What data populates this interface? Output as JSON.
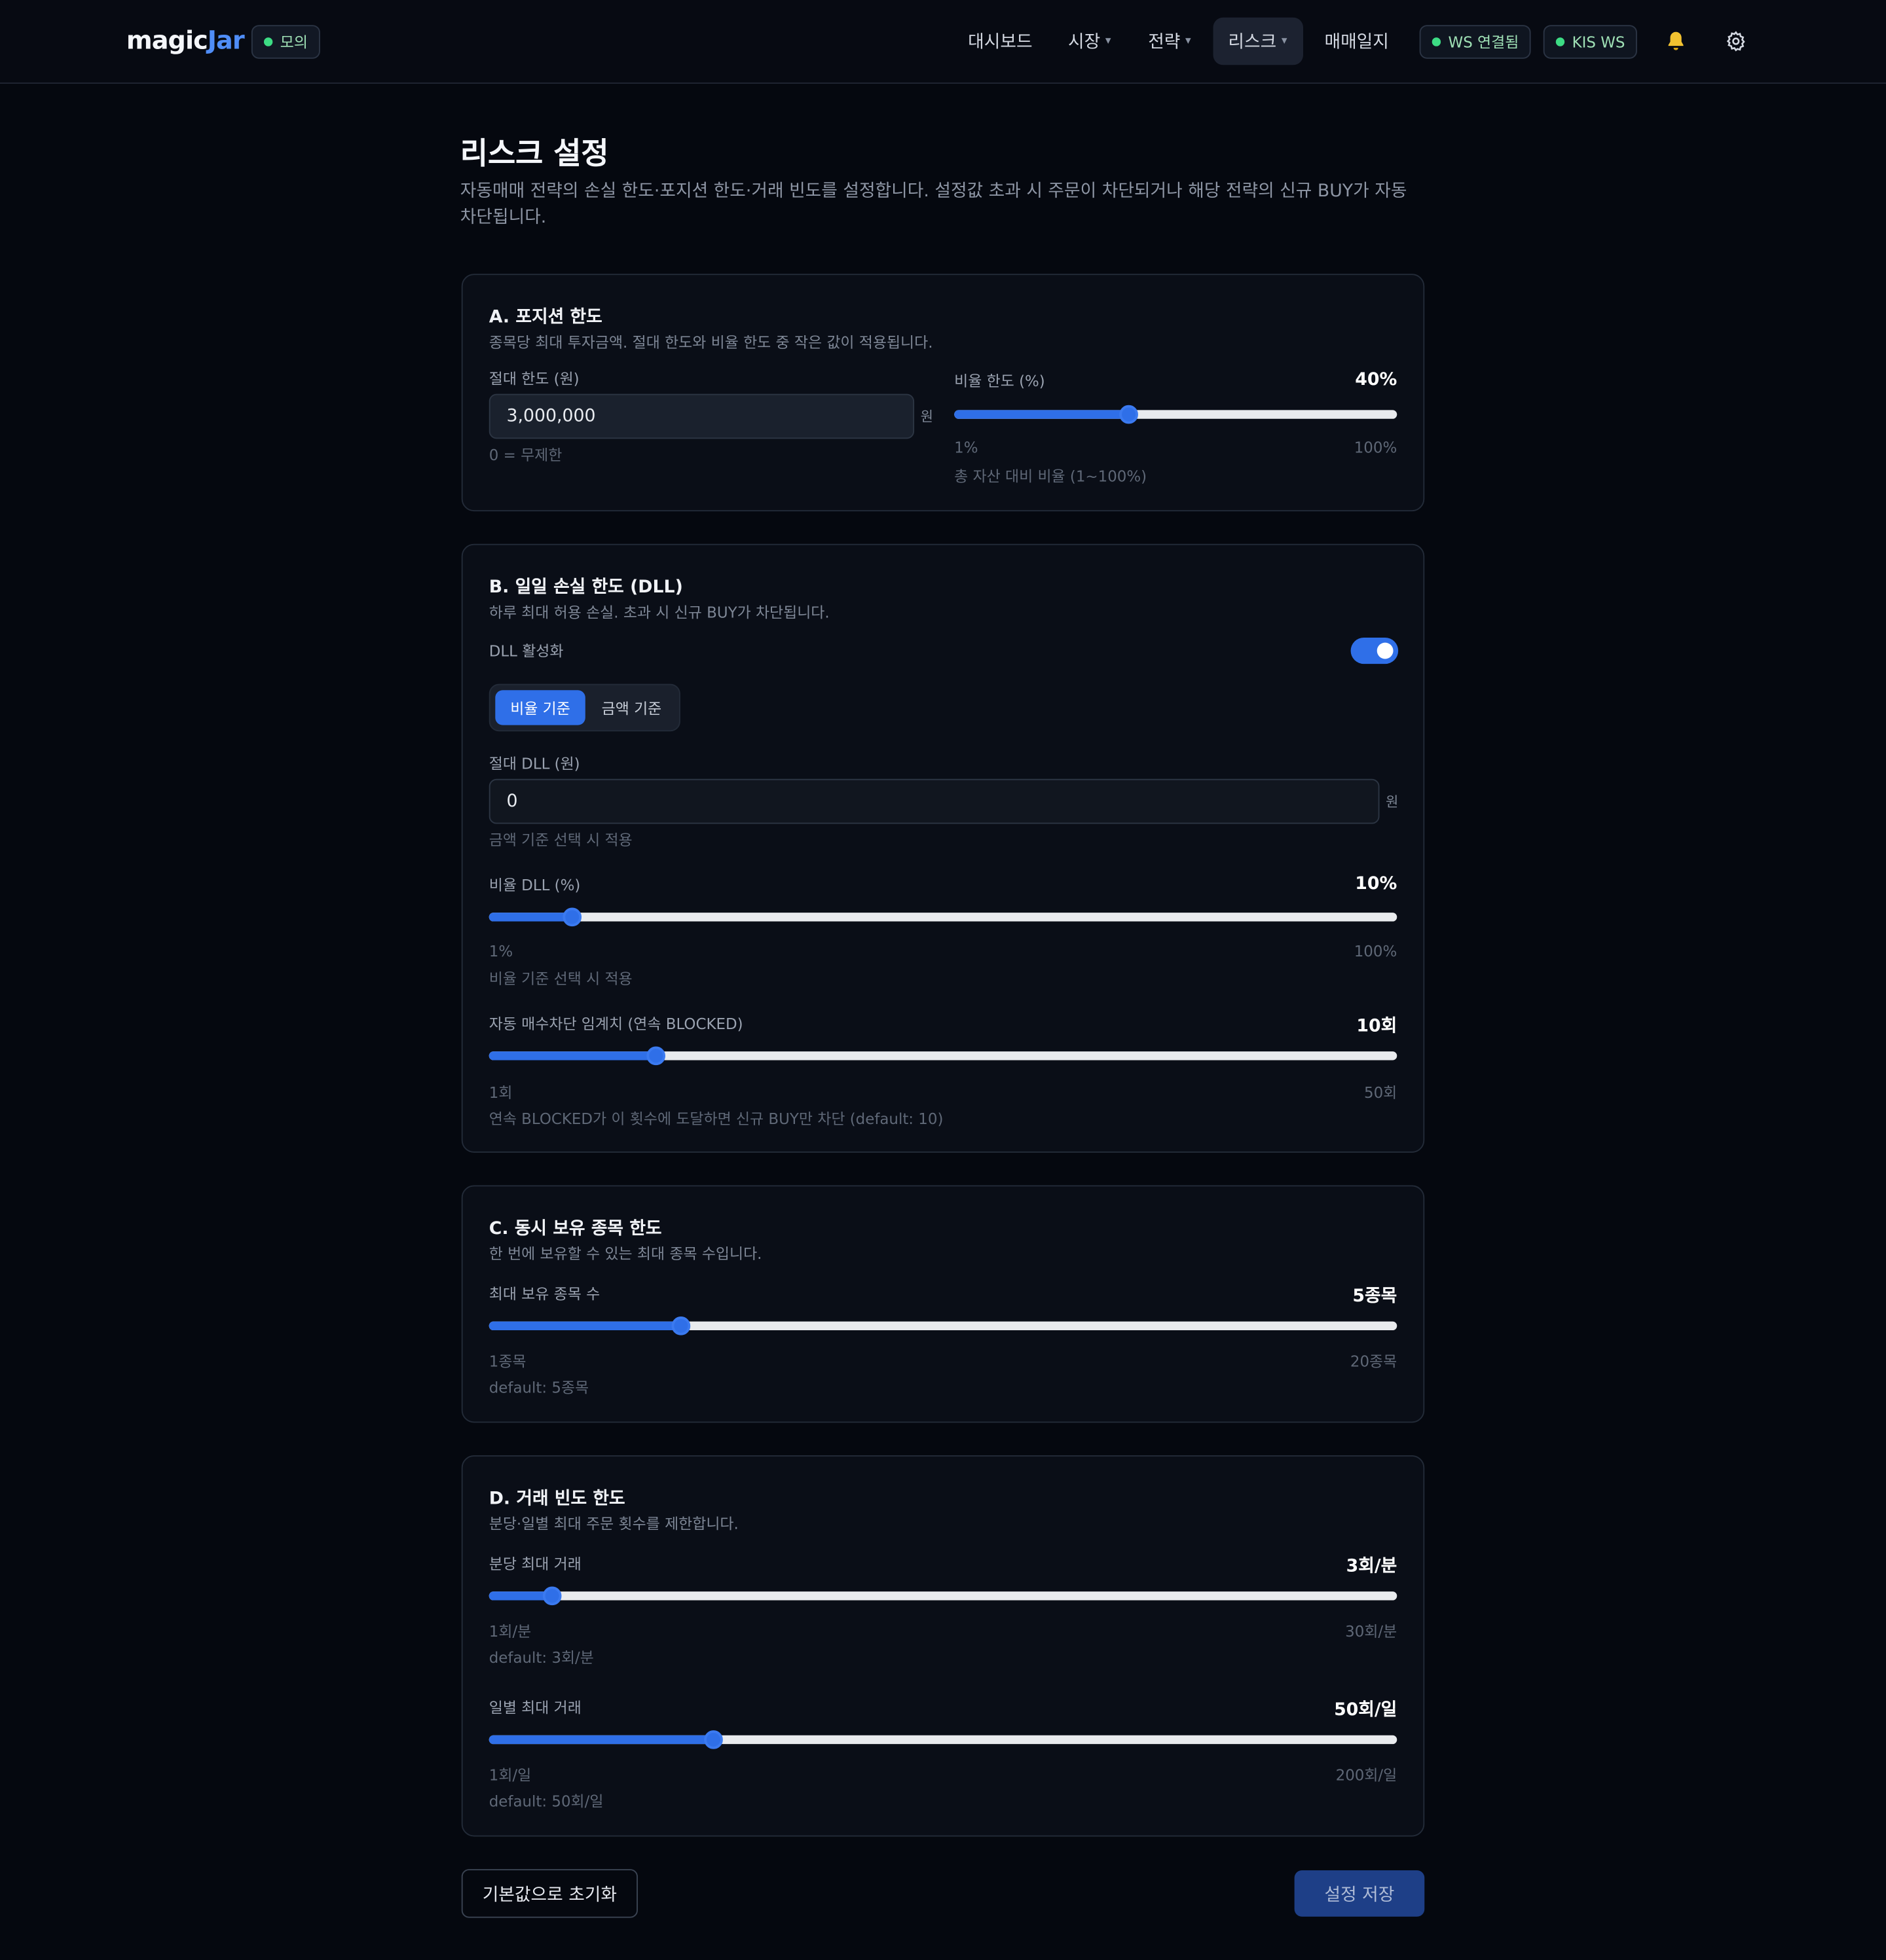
{
  "header": {
    "logo_main": "magic",
    "logo_accent": "Jar",
    "mode_badge": "모의",
    "nav": [
      {
        "label": "대시보드",
        "has_chevron": false
      },
      {
        "label": "시장",
        "has_chevron": true
      },
      {
        "label": "전략",
        "has_chevron": true
      },
      {
        "label": "리스크",
        "has_chevron": true,
        "active": true
      },
      {
        "label": "매매일지",
        "has_chevron": false
      }
    ],
    "ws_status": "WS 연결됨",
    "kis_status": "KIS WS",
    "bell_icon": "bell-icon",
    "settings_icon": "gear-icon"
  },
  "page": {
    "title": "리스크 설정",
    "description": "자동매매 전략의 손실 한도·포지션 한도·거래 빈도를 설정합니다. 설정값 초과 시 주문이 차단되거나 해당 전략의 신규 BUY가 자동 차단됩니다."
  },
  "position": {
    "title": "A. 포지션 한도",
    "subtitle": "종목당 최대 투자금액. 절대 한도와 비율 한도 중 작은 값이 적용됩니다.",
    "abs_label": "절대 한도 (원)",
    "abs_value": "3,000,000",
    "abs_unit": "원",
    "abs_hint": "0 = 무제한",
    "ratio_label": "비율 한도 (%)",
    "ratio_display": "40%",
    "ratio_value": 40,
    "ratio_min": 1,
    "ratio_max": 100,
    "ratio_min_label": "1%",
    "ratio_max_label": "100%",
    "ratio_hint": "총 자산 대비 비율 (1~100%)"
  },
  "dll": {
    "title": "B. 일일 손실 한도 (DLL)",
    "subtitle": "하루 최대 허용 손실. 초과 시 신규 BUY가 차단됩니다.",
    "enable_label": "DLL 활성화",
    "enabled": true,
    "mode_ratio": "비율 기준",
    "mode_amount": "금액 기준",
    "abs_label": "절대 DLL (원)",
    "abs_value": "0",
    "abs_unit": "원",
    "abs_hint": "금액 기준 선택 시 적용",
    "ratio_label": "비율 DLL (%)",
    "ratio_display": "10%",
    "ratio_value": 10,
    "ratio_min": 1,
    "ratio_max": 100,
    "ratio_min_label": "1%",
    "ratio_max_label": "100%",
    "ratio_hint": "비율 기준 선택 시 적용",
    "block_label": "자동 매수차단 임계치 (연속 BLOCKED)",
    "block_display": "10회",
    "block_value": 10,
    "block_min": 1,
    "block_max": 50,
    "block_min_label": "1회",
    "block_max_label": "50회",
    "block_hint": "연속 BLOCKED가 이 횟수에 도달하면 신규 BUY만 차단 (default: 10)"
  },
  "holdings": {
    "title": "C. 동시 보유 종목 한도",
    "subtitle": "한 번에 보유할 수 있는 최대 종목 수입니다.",
    "label": "최대 보유 종목 수",
    "display": "5종목",
    "value": 5,
    "min": 1,
    "max": 20,
    "min_label": "1종목",
    "max_label": "20종목",
    "hint": "default: 5종목"
  },
  "frequency": {
    "title": "D. 거래 빈도 한도",
    "subtitle": "분당·일별 최대 주문 횟수를 제한합니다.",
    "minute_label": "분당 최대 거래",
    "minute_display": "3회/분",
    "minute_value": 3,
    "minute_min": 1,
    "minute_max": 30,
    "minute_min_label": "1회/분",
    "minute_max_label": "30회/분",
    "minute_hint": "default: 3회/분",
    "day_label": "일별 최대 거래",
    "day_display": "50회/일",
    "day_value": 50,
    "day_min": 1,
    "day_max": 200,
    "day_min_label": "1회/일",
    "day_max_label": "200회/일",
    "day_hint": "default: 50회/일"
  },
  "actions": {
    "reset": "기본값으로 초기화",
    "save": "설정 저장"
  },
  "colors": {
    "accent": "#2f6fe8",
    "status_green": "#3ddc84",
    "background": "#05080f"
  }
}
